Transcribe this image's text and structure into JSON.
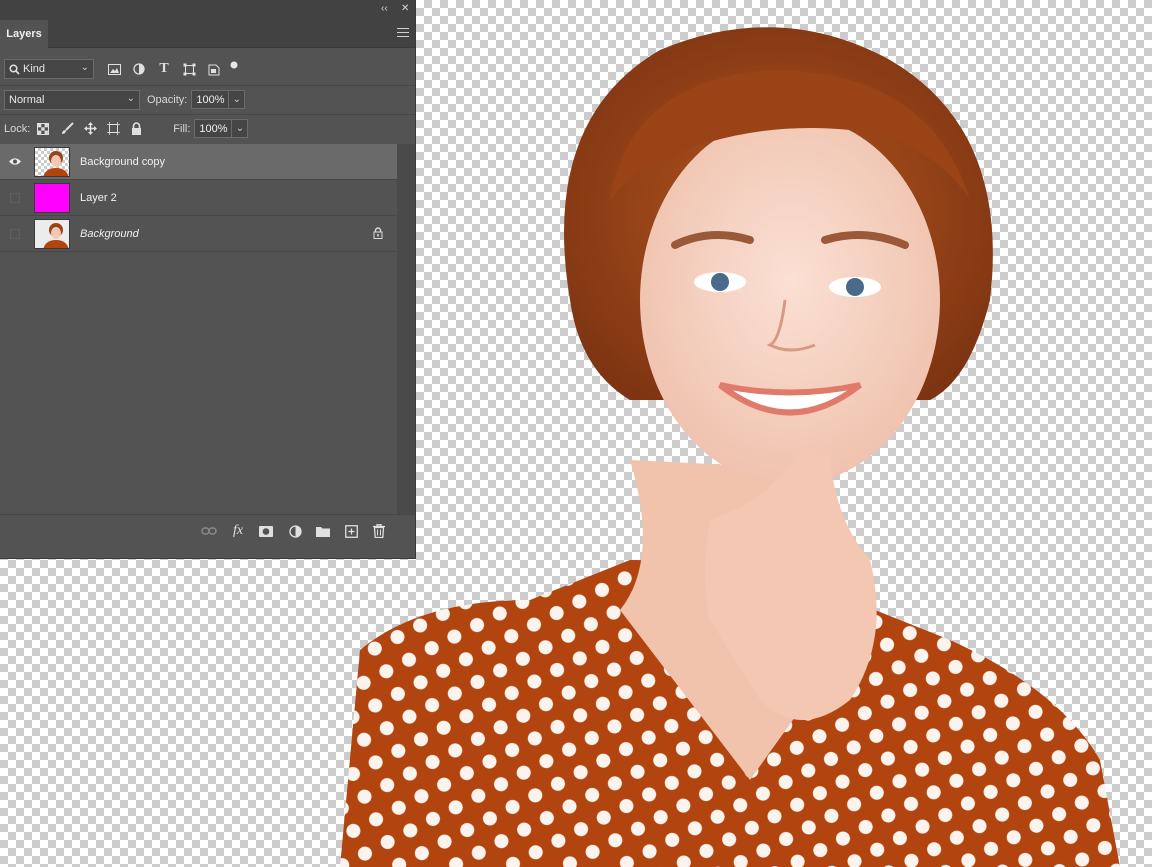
{
  "panel": {
    "collapse_glyph": "‹‹",
    "close_glyph": "✕",
    "tab_label": "Layers",
    "filter": {
      "kind_label": "Kind",
      "icons": [
        "image-filter-icon",
        "adjustment-filter-icon",
        "type-filter-icon",
        "shape-filter-icon",
        "smart-object-filter-icon",
        "filter-toggle-icon"
      ]
    },
    "blend_mode": "Normal",
    "opacity_label": "Opacity:",
    "opacity_value": "100%",
    "lock_label": "Lock:",
    "fill_label": "Fill:",
    "fill_value": "100%",
    "layers": [
      {
        "name": "Background copy",
        "visible": true,
        "selected": true,
        "italic": false,
        "thumb": "photo-transparent",
        "locked": false
      },
      {
        "name": "Layer 2",
        "visible": false,
        "selected": false,
        "italic": false,
        "thumb": "magenta",
        "locked": false
      },
      {
        "name": "Background",
        "visible": false,
        "selected": false,
        "italic": true,
        "thumb": "photo",
        "locked": true
      }
    ],
    "footer_icons": [
      "link-layers-icon",
      "fx-icon",
      "layer-mask-icon",
      "adjustment-layer-icon",
      "new-group-icon",
      "new-layer-icon",
      "delete-layer-icon"
    ]
  },
  "colors": {
    "magenta_swatch": "#ff00ff",
    "panel_bg": "#535353",
    "selected_row": "#6a6a6a"
  }
}
